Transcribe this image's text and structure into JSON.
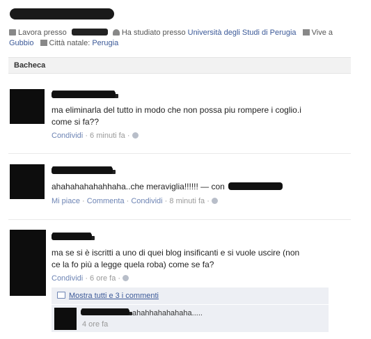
{
  "profile": {
    "work_label": "Lavora presso",
    "studied_label": "Ha studiato presso",
    "university": "Università degli Studi di Perugia",
    "lives_label": "Vive a",
    "lives_city": "Gubbio",
    "hometown_label": "Città natale:",
    "hometown_city": "Perugia"
  },
  "wall": {
    "title": "Bacheca"
  },
  "posts": [
    {
      "text_line1": "ma eliminarla del tutto in modo che non possa piu rompere i coglio.i",
      "text_line2": "come si fa??",
      "share": "Condividi",
      "time": "6 minuti fa"
    },
    {
      "text": "ahahahahahahhaha..che meraviglia!!!!!! — con",
      "like": "Mi piace",
      "comment": "Commenta",
      "share": "Condividi",
      "time": "8 minuti fa"
    },
    {
      "text_line1": "ma se si è iscritti a uno di quei blog insificanti e si vuole uscire (non",
      "text_line2": "ce la fo più a legge quela roba) come se fa?",
      "share": "Condividi",
      "time": "6 ore fa",
      "comments": {
        "show_all": "Mostra tutti e 3 i commenti",
        "comment_text": "ahahhahahahaha.....",
        "comment_time": "4 ore fa"
      }
    }
  ],
  "separator": "·",
  "colors": {
    "link": "#3b5998",
    "meta_link": "#6d84b4",
    "comment_bg": "#edeff4"
  }
}
